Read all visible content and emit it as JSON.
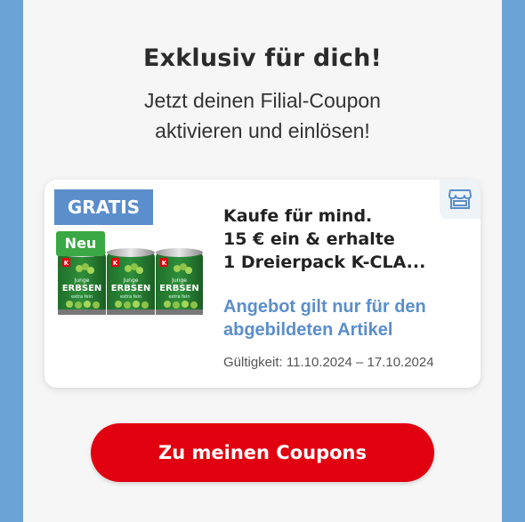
{
  "heading": "Exklusiv für dich!",
  "subheading_line1": "Jetzt deinen Filial-Coupon",
  "subheading_line2": "aktivieren und einlösen!",
  "coupon": {
    "badge": "GRATIS",
    "new_badge": "Neu",
    "title_line1": "Kaufe für mind.",
    "title_line2": "15 € ein & erhalte",
    "title_line3": "1 Dreierpack K-CLA...",
    "note_line1": "Angebot gilt nur für den",
    "note_line2": "abgebildeten Artikel",
    "validity": "Gültigkeit: 11.10.2024 – 17.10.2024",
    "product_can_brand": "K",
    "product_can_line1": "Junge",
    "product_can_line2": "ERBSEN",
    "product_can_line3": "extra fein",
    "store_icon": "store-icon"
  },
  "cta_label": "Zu meinen Coupons",
  "colors": {
    "background_side": "#6fa8dc",
    "badge_blue": "#5b8ecb",
    "badge_green": "#3aa844",
    "cta_red": "#e1000f"
  }
}
